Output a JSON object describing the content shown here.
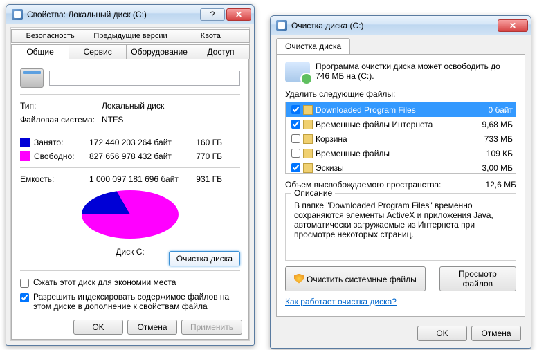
{
  "left": {
    "title": "Свойства: Локальный диск (C:)",
    "tabs_row1": [
      "Безопасность",
      "Предыдущие версии",
      "Квота"
    ],
    "tabs_row2": [
      "Общие",
      "Сервис",
      "Оборудование",
      "Доступ"
    ],
    "active_tab": "Общие",
    "disk_label": "",
    "type_label": "Тип:",
    "type_value": "Локальный диск",
    "fs_label": "Файловая система:",
    "fs_value": "NTFS",
    "used_label": "Занято:",
    "used_bytes": "172 440 203 264 байт",
    "used_gb": "160 ГБ",
    "used_color": "#0000d6",
    "free_label": "Свободно:",
    "free_bytes": "827 656 978 432 байт",
    "free_gb": "770 ГБ",
    "free_color": "#ff00ff",
    "cap_label": "Емкость:",
    "cap_bytes": "1 000 097 181 696 байт",
    "cap_gb": "931 ГБ",
    "pie_label": "Диск C:",
    "clean_button": "Очистка диска",
    "compress_label": "Сжать этот диск для экономии места",
    "compress_checked": false,
    "index_label": "Разрешить индексировать содержимое файлов на этом диске в дополнение к свойствам файла",
    "index_checked": true,
    "ok": "OK",
    "cancel": "Отмена",
    "apply": "Применить"
  },
  "right": {
    "title": "Очистка диска  (C:)",
    "tab": "Очистка диска",
    "info": "Программа очистки диска может освободить до 746 МБ на  (C:).",
    "delete_label": "Удалить следующие файлы:",
    "files": [
      {
        "checked": true,
        "name": "Downloaded Program Files",
        "size": "0 байт",
        "selected": true
      },
      {
        "checked": true,
        "name": "Временные файлы Интернета",
        "size": "9,68 МБ",
        "selected": false
      },
      {
        "checked": false,
        "name": "Корзина",
        "size": "733 МБ",
        "selected": false
      },
      {
        "checked": false,
        "name": "Временные файлы",
        "size": "109 КБ",
        "selected": false
      },
      {
        "checked": true,
        "name": "Эскизы",
        "size": "3,00 МБ",
        "selected": false
      }
    ],
    "total_label": "Объем высвобождаемого пространства:",
    "total_value": "12,6 МБ",
    "desc_title": "Описание",
    "desc_text": "В папке \"Downloaded Program Files\" временно сохраняются элементы ActiveX и приложения Java, автоматически загружаемые из Интернета при просмотре некоторых страниц.",
    "clean_sys": "Очистить системные файлы",
    "view_files": "Просмотр файлов",
    "link": "Как работает очистка диска?",
    "ok": "OK",
    "cancel": "Отмена"
  }
}
